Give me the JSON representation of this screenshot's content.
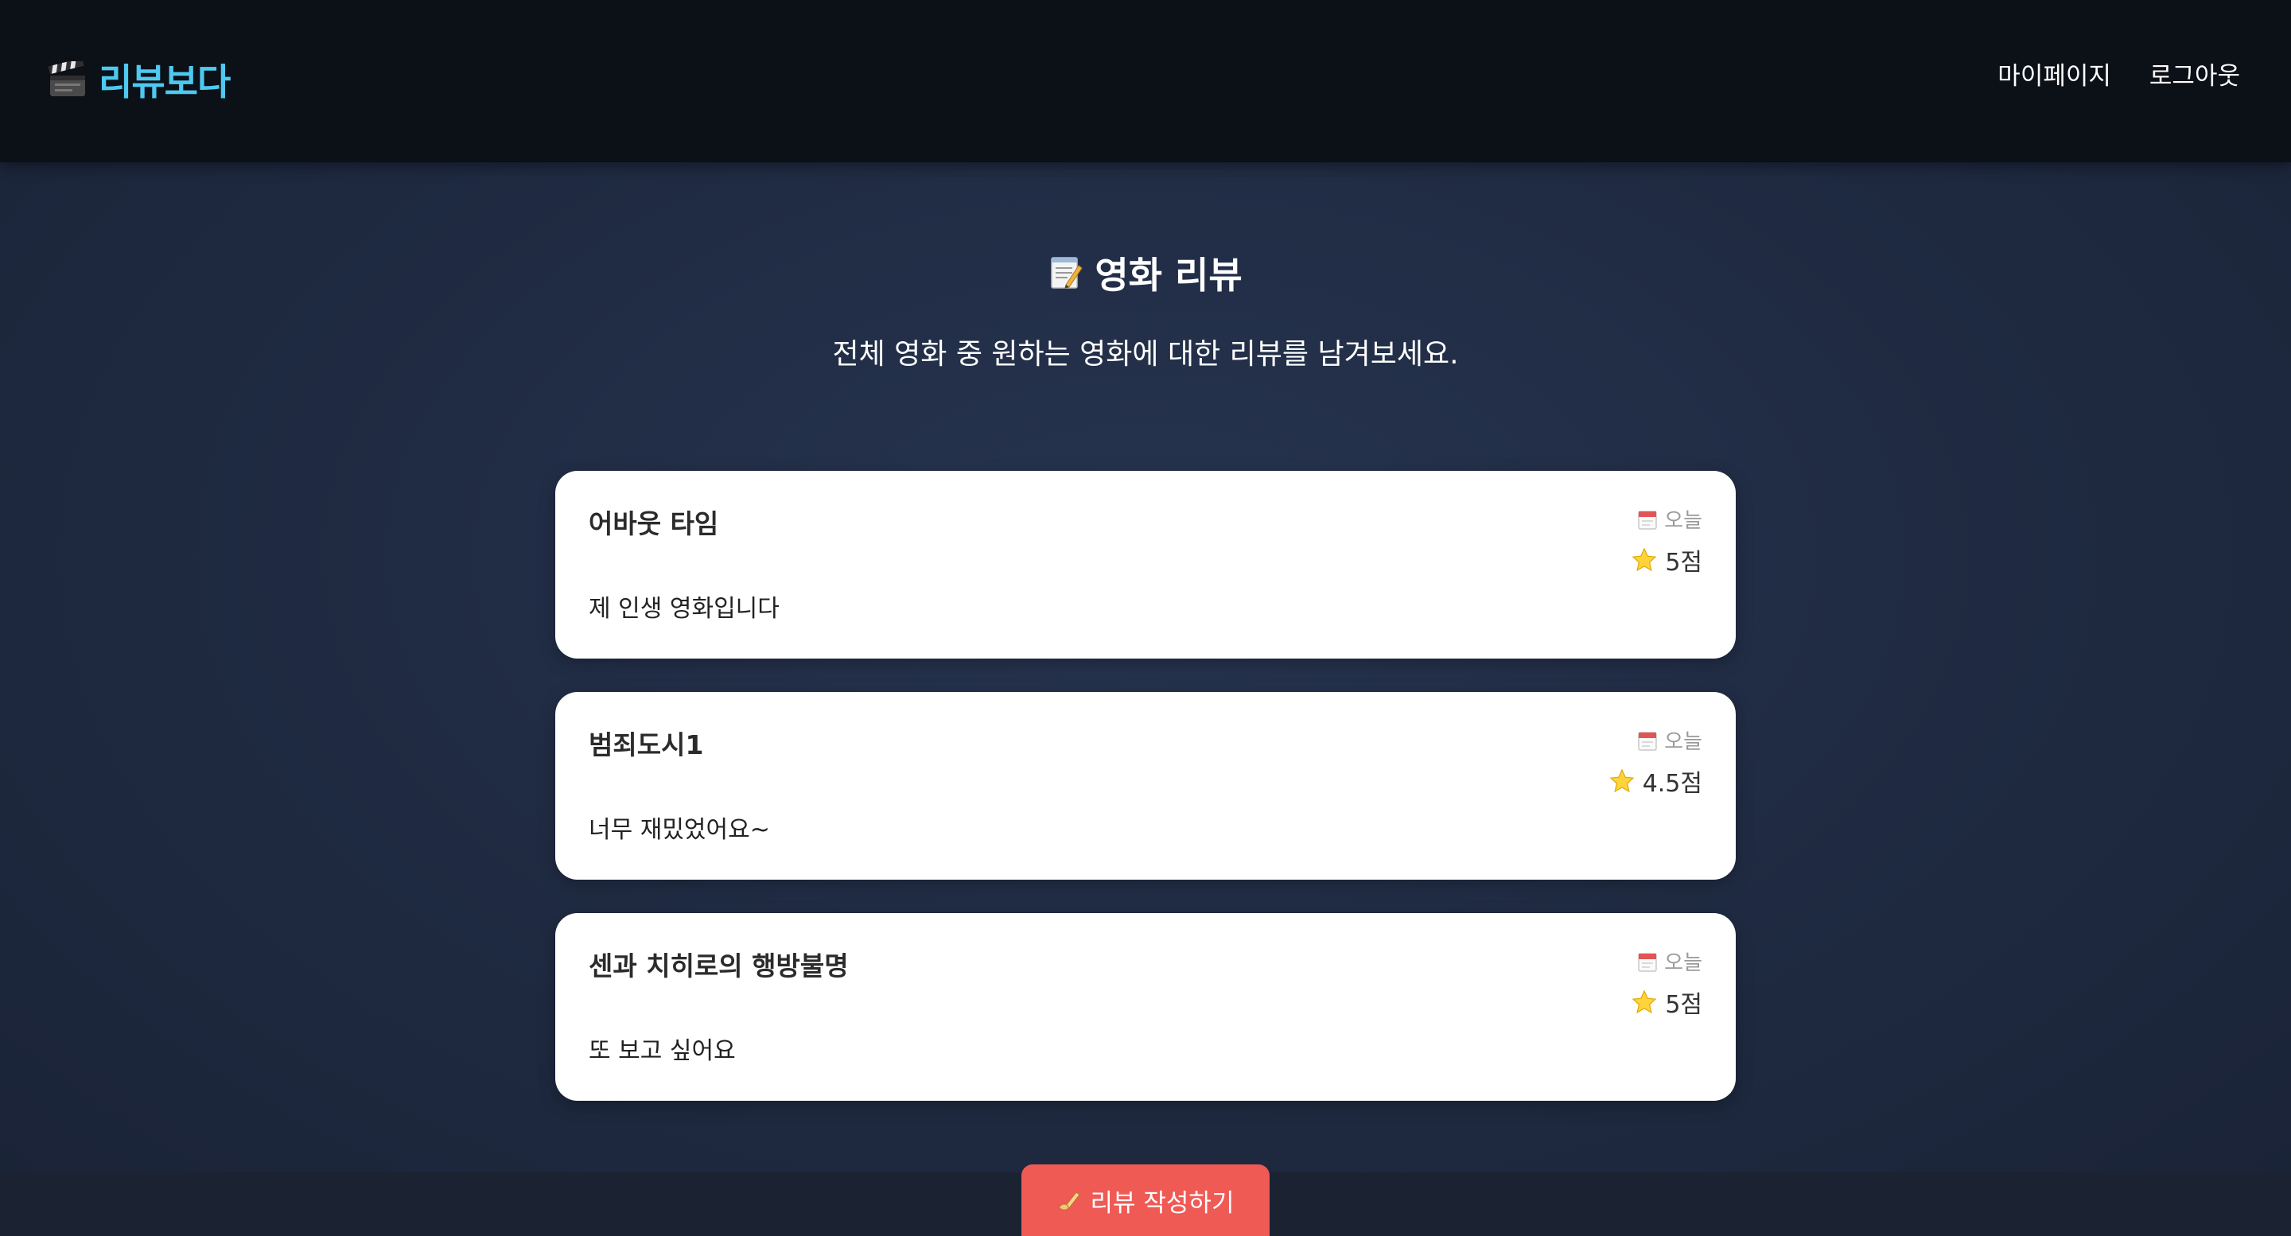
{
  "header": {
    "logo_text": "리뷰보다",
    "logo_icon": "clapperboard-icon",
    "nav": [
      {
        "label": "마이페이지"
      },
      {
        "label": "로그아웃"
      }
    ]
  },
  "main": {
    "title": "영화 리뷰",
    "title_icon": "memo-icon",
    "subtitle": "전체 영화 중 원하는 영화에 대한 리뷰를 남겨보세요."
  },
  "reviews": [
    {
      "movie": "어바웃 타임",
      "date": "오늘",
      "rating": "5점",
      "content": "제 인생 영화입니다"
    },
    {
      "movie": "범죄도시1",
      "date": "오늘",
      "rating": "4.5점",
      "content": "너무 재밌었어요~"
    },
    {
      "movie": "센과 치히로의 행방불명",
      "date": "오늘",
      "rating": "5점",
      "content": "또 보고 싶어요"
    }
  ],
  "actions": {
    "write_label": "리뷰 작성하기",
    "write_icon": "writing-hand-icon"
  },
  "colors": {
    "header_bg": "#0c1017",
    "logo": "#4ec9f0",
    "page_bg": "#1e2940",
    "card_bg": "#ffffff",
    "accent_button": "#ef5a55"
  }
}
